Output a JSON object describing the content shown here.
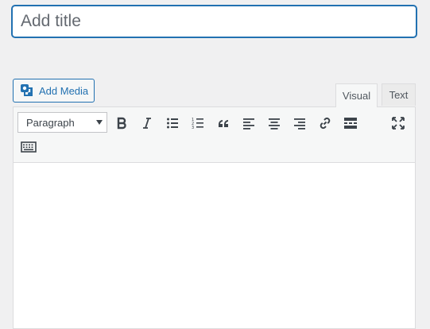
{
  "title_field": {
    "placeholder": "Add title",
    "value": ""
  },
  "add_media": {
    "label": "Add Media",
    "icon": "add-media-icon"
  },
  "tabs": [
    {
      "label": "Visual",
      "active": true
    },
    {
      "label": "Text",
      "active": false
    }
  ],
  "toolbar": {
    "format_select": {
      "value": "Paragraph"
    },
    "buttons": [
      {
        "name": "bold",
        "icon": "bold-icon"
      },
      {
        "name": "italic",
        "icon": "italic-icon"
      },
      {
        "name": "bulleted-list",
        "icon": "bulleted-list-icon"
      },
      {
        "name": "numbered-list",
        "icon": "numbered-list-icon"
      },
      {
        "name": "blockquote",
        "icon": "blockquote-icon"
      },
      {
        "name": "align-left",
        "icon": "align-left-icon"
      },
      {
        "name": "align-center",
        "icon": "align-center-icon"
      },
      {
        "name": "align-right",
        "icon": "align-right-icon"
      },
      {
        "name": "insert-link",
        "icon": "link-icon"
      },
      {
        "name": "read-more",
        "icon": "read-more-icon"
      },
      {
        "name": "fullscreen",
        "icon": "fullscreen-icon"
      },
      {
        "name": "toolbar-toggle",
        "icon": "keyboard-icon"
      }
    ]
  },
  "colors": {
    "accent": "#2271b1",
    "icon": "#3c434a",
    "background": "#f0f0f1"
  }
}
